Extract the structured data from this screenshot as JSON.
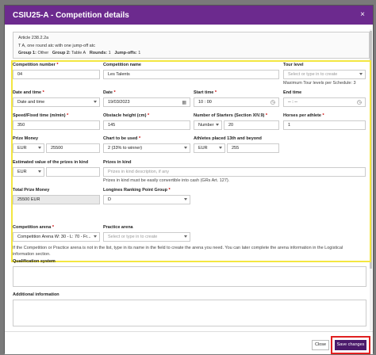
{
  "modal": {
    "title": "CSIU25-A - Competition details",
    "close_symbol": "×"
  },
  "info": {
    "article": "Article 238.2.2a",
    "description": "T A, one round atc with one jump-off atc",
    "group1_label": "Group 1:",
    "group1_value": "Other",
    "group2_label": "Group 2:",
    "group2_value": "Table A",
    "rounds_label": "Rounds:",
    "rounds_value": "1",
    "jumpoffs_label": "Jump-offs:",
    "jumpoffs_value": "1"
  },
  "fields": {
    "competition_number_label": "Competition number",
    "competition_number_value": "04",
    "competition_name_label": "Competition name",
    "competition_name_value": "Les Talents",
    "tour_level_label": "Tour level",
    "tour_level_placeholder": "Select or type in to create",
    "tour_level_hint": "Maximum Tour levels per Schedule: 3",
    "date_time_label": "Date and time",
    "date_time_value": "Date and time",
    "date_label": "Date",
    "date_value": "19/03/2023",
    "start_time_label": "Start time",
    "start_time_value": "10 : 00",
    "end_time_label": "End time",
    "end_time_value": "-- : --",
    "speed_label": "Speed/Fixed time (m/min)",
    "speed_value": "350",
    "obstacle_height_label": "Obstacle height (cm)",
    "obstacle_height_value": "145",
    "starters_label": "Number of Starters (Section XIV.9)",
    "starters_select": "Number",
    "starters_value": "20",
    "horses_per_athlete_label": "Horses per athlete",
    "horses_per_athlete_value": "1",
    "prize_money_label": "Prize Money",
    "prize_money_currency": "EUR",
    "prize_money_value": "25500",
    "chart_label": "Chart to be used",
    "chart_value": "2 (33% to winner)",
    "athletes_placed_label": "Athletes placed 13th and beyond",
    "athletes_placed_currency": "EUR",
    "athletes_placed_value": "255",
    "est_prizes_label": "Estimated value of the prizes in kind",
    "est_prizes_currency": "EUR",
    "prizes_in_kind_label": "Prizes in kind",
    "prizes_in_kind_placeholder": "Prizes in kind description, if any",
    "prizes_in_kind_hint": "Prizes in kind must be easily convertible into cash (GRs Art. 127).",
    "total_prize_label": "Total Prize Money",
    "total_prize_value": "25500 EUR",
    "longines_label": "Longines Ranking Point Group",
    "longines_value": "D",
    "arena_label": "Competition arena",
    "arena_value": "Competition Arena W: 30 - L: 70 - Fr...",
    "practice_arena_label": "Practice arena",
    "practice_arena_placeholder": "Select or type in to create",
    "arena_hint": "If the Competition or Practice arena is not in the list, type in its name in the field to create the arena you need. You can later complete the arena information in the Logistical information section.",
    "qualification_label": "Qualification system",
    "additional_info_label": "Additional information",
    "required_mark": "*"
  },
  "footer": {
    "close_label": "Close",
    "save_label": "Save changes"
  },
  "colors": {
    "header": "#6c2a8e",
    "save_button": "#4b1a6b",
    "highlight_border": "#f3e641",
    "save_ring": "#e02020"
  }
}
